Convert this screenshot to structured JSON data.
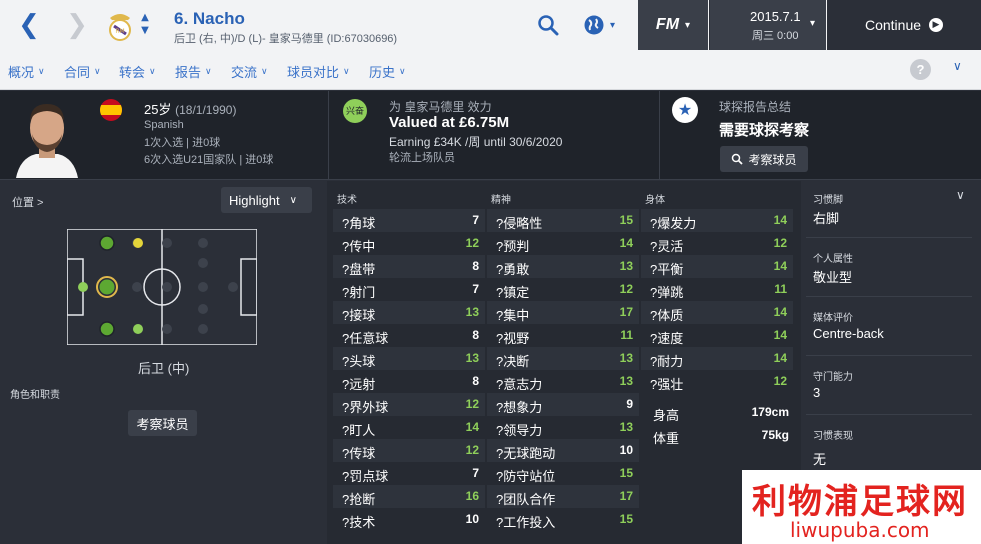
{
  "topbar": {
    "player_name": "6. Nacho",
    "player_sub": "后卫 (右, 中)/D (L)- 皇家马德里 (ID:67030696)",
    "date": "2015.7.1",
    "time": "周三 0:00",
    "fm_label": "FM",
    "continue_label": "Continue"
  },
  "menu": [
    "概况",
    "合同",
    "转会",
    "报告",
    "交流",
    "球员对比",
    "历史"
  ],
  "help_label": "?",
  "header": {
    "age": "25岁",
    "dob": "(18/1/1990)",
    "nationality": "Spanish",
    "caps1": "1次入选 | 进0球",
    "caps2": "6次入选U21国家队 | 进0球",
    "morale_label": "兴奋",
    "club_line": "为 皇家马德里 效力",
    "value": "Valued at £6.75M",
    "earning": "Earning £34K /周 until 30/6/2020",
    "squad_status": "轮流上场队员",
    "scout_title": "球探报告总结",
    "scout_need": "需要球探考察",
    "scout_btn": "考察球员"
  },
  "left": {
    "position_label": "位置 >",
    "highlight": "Highlight",
    "position_text": "后卫 (中)",
    "role_label": "角色和职责",
    "scout_btn": "考察球员"
  },
  "attributes": {
    "technical_title": "技术",
    "mental_title": "精神",
    "physical_title": "身体",
    "technical": [
      {
        "name": "?角球",
        "value": "7"
      },
      {
        "name": "?传中",
        "value": "12"
      },
      {
        "name": "?盘带",
        "value": "8"
      },
      {
        "name": "?射门",
        "value": "7"
      },
      {
        "name": "?接球",
        "value": "13"
      },
      {
        "name": "?任意球",
        "value": "8"
      },
      {
        "name": "?头球",
        "value": "13"
      },
      {
        "name": "?远射",
        "value": "8"
      },
      {
        "name": "?界外球",
        "value": "12"
      },
      {
        "name": "?盯人",
        "value": "14"
      },
      {
        "name": "?传球",
        "value": "12"
      },
      {
        "name": "?罚点球",
        "value": "7"
      },
      {
        "name": "?抢断",
        "value": "16"
      },
      {
        "name": "?技术",
        "value": "10"
      }
    ],
    "mental": [
      {
        "name": "?侵略性",
        "value": "15"
      },
      {
        "name": "?预判",
        "value": "14"
      },
      {
        "name": "?勇敢",
        "value": "13"
      },
      {
        "name": "?镇定",
        "value": "12"
      },
      {
        "name": "?集中",
        "value": "17"
      },
      {
        "name": "?视野",
        "value": "11"
      },
      {
        "name": "?决断",
        "value": "13"
      },
      {
        "name": "?意志力",
        "value": "13"
      },
      {
        "name": "?想象力",
        "value": "9"
      },
      {
        "name": "?领导力",
        "value": "13"
      },
      {
        "name": "?无球跑动",
        "value": "10"
      },
      {
        "name": "?防守站位",
        "value": "15"
      },
      {
        "name": "?团队合作",
        "value": "17"
      },
      {
        "name": "?工作投入",
        "value": "15"
      }
    ],
    "physical": [
      {
        "name": "?爆发力",
        "value": "14"
      },
      {
        "name": "?灵活",
        "value": "12"
      },
      {
        "name": "?平衡",
        "value": "14"
      },
      {
        "name": "?弹跳",
        "value": "11"
      },
      {
        "name": "?体质",
        "value": "14"
      },
      {
        "name": "?速度",
        "value": "14"
      },
      {
        "name": "?耐力",
        "value": "14"
      },
      {
        "name": "?强壮",
        "value": "12"
      }
    ],
    "height_label": "身高",
    "height": "179cm",
    "weight_label": "体重",
    "weight": "75kg"
  },
  "right": {
    "foot_label": "习惯脚",
    "foot": "右脚",
    "personality_label": "个人属性",
    "personality": "敬业型",
    "media_label": "媒体评价",
    "media": "Centre-back",
    "defence_label": "守门能力",
    "defence": "3",
    "habits_label": "习惯表现",
    "habits": "无"
  },
  "watermark": {
    "line1": "利物浦足球网",
    "line2": "liwupuba.com"
  },
  "colors": {
    "accent": "#2a62b5",
    "good": "#8fcf5a",
    "dark": "#2b2f38"
  }
}
